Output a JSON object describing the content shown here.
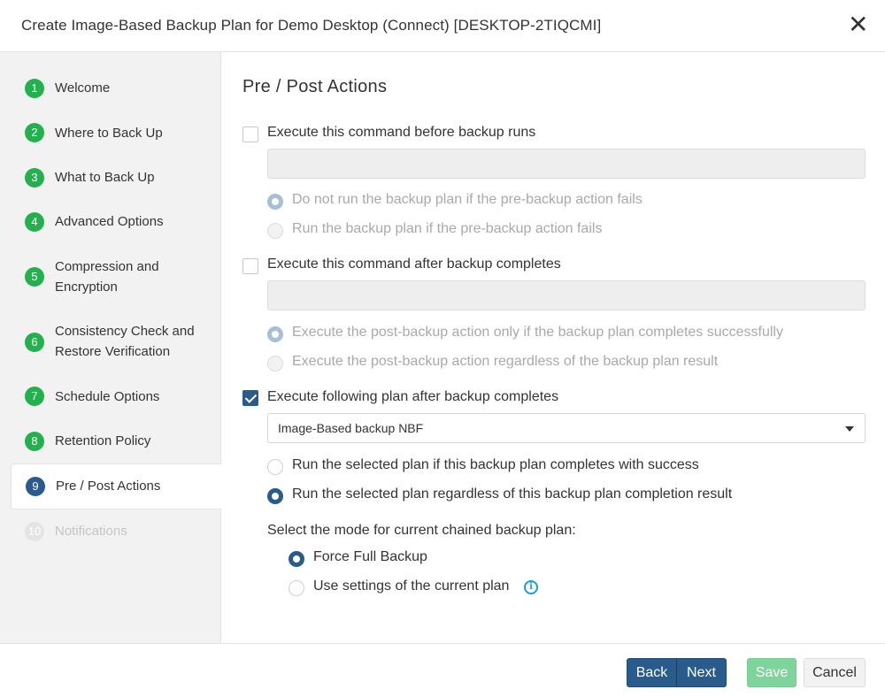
{
  "dialog": {
    "title": "Create Image-Based Backup Plan for Demo Desktop (Connect) [DESKTOP-2TIQCMI]",
    "close_glyph": "✕"
  },
  "steps": [
    {
      "num": "1",
      "label": "Welcome",
      "state": "done"
    },
    {
      "num": "2",
      "label": "Where to Back Up",
      "state": "done"
    },
    {
      "num": "3",
      "label": "What to Back Up",
      "state": "done"
    },
    {
      "num": "4",
      "label": "Advanced Options",
      "state": "done"
    },
    {
      "num": "5",
      "label": "Compression and Encryption",
      "state": "done"
    },
    {
      "num": "6",
      "label": "Consistency Check and Restore Verification",
      "state": "done"
    },
    {
      "num": "7",
      "label": "Schedule Options",
      "state": "done"
    },
    {
      "num": "8",
      "label": "Retention Policy",
      "state": "done"
    },
    {
      "num": "9",
      "label": "Pre / Post Actions",
      "state": "active"
    },
    {
      "num": "10",
      "label": "Notifications",
      "state": "disabled"
    }
  ],
  "main": {
    "title": "Pre / Post Actions",
    "pre": {
      "label": "Execute this command before backup runs",
      "checked": false,
      "command_value": "",
      "options": [
        {
          "label": "Do not run the backup plan if the pre-backup action fails",
          "selected": true
        },
        {
          "label": "Run the backup plan if the pre-backup action fails",
          "selected": false
        }
      ]
    },
    "post": {
      "label": "Execute this command after backup completes",
      "checked": false,
      "command_value": "",
      "options": [
        {
          "label": "Execute the post-backup action only if the backup plan completes successfully",
          "selected": true
        },
        {
          "label": "Execute the post-backup action regardless of the backup plan result",
          "selected": false
        }
      ]
    },
    "chain": {
      "label": "Execute following plan after backup completes",
      "checked": true,
      "selected_plan": "Image-Based backup NBF",
      "options": [
        {
          "label": "Run the selected plan if this backup plan completes with success",
          "selected": false
        },
        {
          "label": "Run the selected plan regardless of this backup plan completion result",
          "selected": true
        }
      ],
      "mode_label": "Select the mode for current chained backup plan:",
      "modes": [
        {
          "label": "Force Full Backup",
          "selected": true
        },
        {
          "label": "Use settings of the current plan",
          "selected": false
        }
      ],
      "info_glyph": "i"
    }
  },
  "footer": {
    "back_label": "Back",
    "next_label": "Next",
    "save_label": "Save",
    "cancel_label": "Cancel"
  },
  "colors": {
    "primary": "#2a5b8d",
    "step_done": "#23b14d",
    "save_disabled": "#7ed49a",
    "info": "#1a9dd9"
  }
}
